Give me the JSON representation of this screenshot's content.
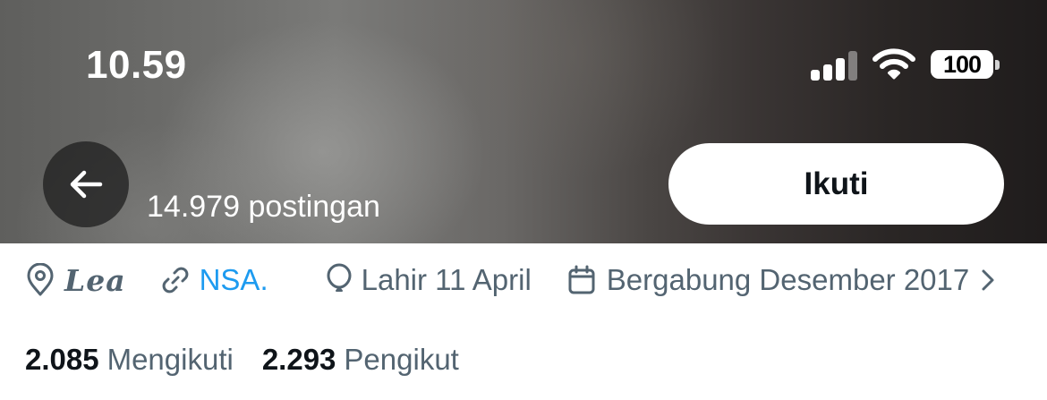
{
  "status_bar": {
    "time": "10.59",
    "battery": "100",
    "icons": [
      "signal-icon",
      "wifi-icon",
      "battery-icon"
    ]
  },
  "header": {
    "back_icon": "arrow-left-icon",
    "post_count": "14.979 postingan",
    "follow_label": "Ikuti"
  },
  "profile_info": {
    "location": "Lea",
    "website": "NSA.",
    "birthday": "Lahir 11 April",
    "joined": "Bergabung Desember 2017"
  },
  "stats": {
    "following_count": "2.085",
    "following_label": "Mengikuti",
    "followers_count": "2.293",
    "followers_label": "Pengikut"
  },
  "colors": {
    "link": "#1d9bf0",
    "secondary_text": "#536471",
    "primary_text": "#0f1419"
  }
}
